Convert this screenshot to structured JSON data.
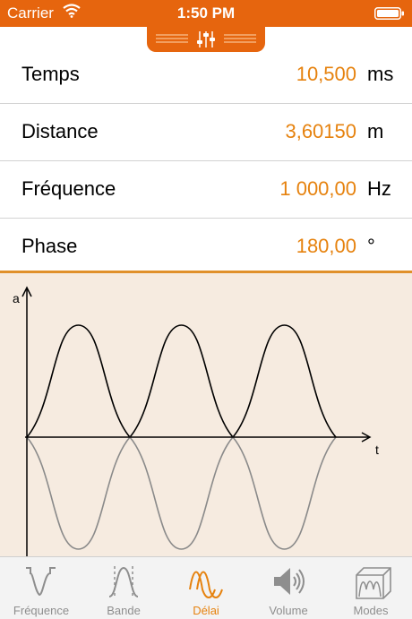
{
  "status_bar": {
    "carrier": "Carrier",
    "time": "1:50 PM"
  },
  "parameters": [
    {
      "label": "Temps",
      "value": "10,500",
      "unit": "ms"
    },
    {
      "label": "Distance",
      "value": "3,60150",
      "unit": "m"
    },
    {
      "label": "Fréquence",
      "value": "1 000,00",
      "unit": "Hz"
    },
    {
      "label": "Phase",
      "value": "180,00",
      "unit": "°"
    }
  ],
  "graph": {
    "y_axis_label": "a",
    "x_axis_label": "t"
  },
  "tabs": [
    {
      "label": "Fréquence",
      "icon": "frequency-icon",
      "active": false
    },
    {
      "label": "Bande",
      "icon": "band-icon",
      "active": false
    },
    {
      "label": "Délai",
      "icon": "delay-icon",
      "active": true
    },
    {
      "label": "Volume",
      "icon": "volume-icon",
      "active": false
    },
    {
      "label": "Modes",
      "icon": "modes-icon",
      "active": false
    }
  ],
  "colors": {
    "accent": "#e6650e",
    "value_text": "#e6820e",
    "graph_bg": "#f6ebe0",
    "tab_inactive": "#8e8e8e"
  }
}
